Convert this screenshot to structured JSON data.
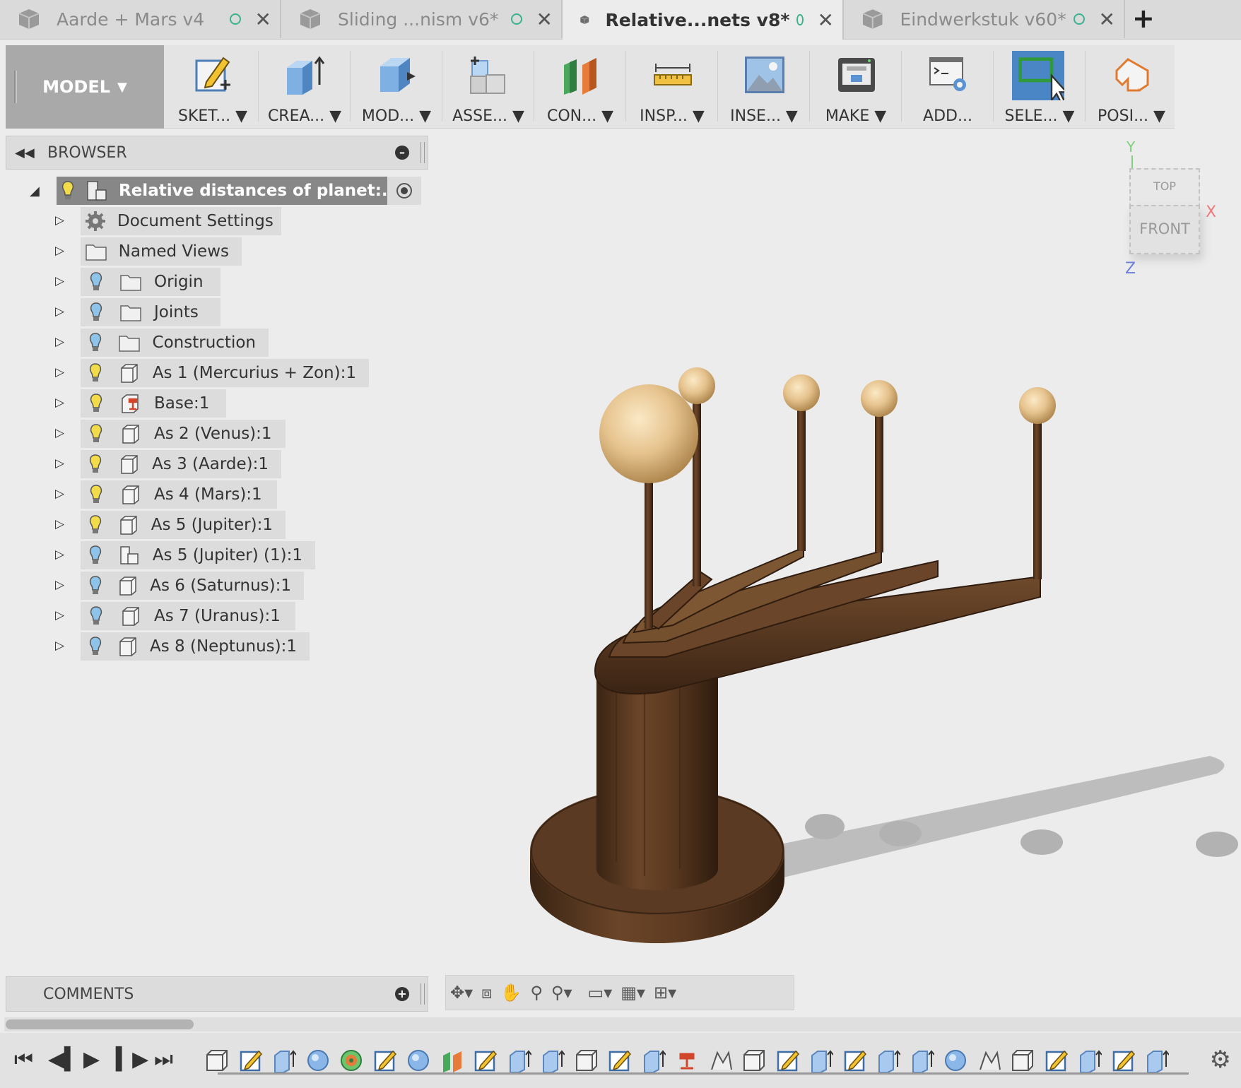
{
  "tabs": [
    {
      "label": "Aarde + Mars v4",
      "active": false
    },
    {
      "label": "Sliding ...nism v6*",
      "active": false
    },
    {
      "label": "Relative...nets v8*",
      "active": true
    },
    {
      "label": "Eindwerkstuk v60*",
      "active": false
    }
  ],
  "new_tab": "+",
  "tab_close": "✕",
  "toolbar": {
    "workspace": "MODEL",
    "tools": [
      {
        "label": "SKET...",
        "icon": "sketch-icon"
      },
      {
        "label": "CREA...",
        "icon": "create-extrude-icon"
      },
      {
        "label": "MOD...",
        "icon": "modify-icon"
      },
      {
        "label": "ASSE...",
        "icon": "assemble-icon"
      },
      {
        "label": "CON...",
        "icon": "construct-icon"
      },
      {
        "label": "INSP...",
        "icon": "inspect-ruler-icon"
      },
      {
        "label": "INSE...",
        "icon": "insert-image-icon"
      },
      {
        "label": "MAKE",
        "icon": "make-3dprint-icon"
      },
      {
        "label": "ADD...",
        "icon": "addins-script-icon"
      },
      {
        "label": "SELE...",
        "icon": "select-icon"
      },
      {
        "label": "POSI...",
        "icon": "position-icon"
      }
    ]
  },
  "browser": {
    "title": "BROWSER",
    "root": "Relative distances of planet:...",
    "items": [
      {
        "label": "Document Settings",
        "icon": "gear-icon",
        "bulb": false
      },
      {
        "label": "Named Views",
        "icon": "folder-icon",
        "bulb": false
      },
      {
        "label": "Origin",
        "icon": "folder-icon",
        "bulb": "blue"
      },
      {
        "label": "Joints",
        "icon": "folder-icon",
        "bulb": "blue"
      },
      {
        "label": "Construction",
        "icon": "folder-icon",
        "bulb": "blue"
      },
      {
        "label": "As 1 (Mercurius + Zon):1",
        "icon": "component-icon",
        "bulb": "yellow"
      },
      {
        "label": "Base:1",
        "icon": "grounded-component-icon",
        "bulb": "yellow"
      },
      {
        "label": "As 2 (Venus):1",
        "icon": "component-icon",
        "bulb": "yellow"
      },
      {
        "label": "As 3 (Aarde):1",
        "icon": "component-icon",
        "bulb": "yellow"
      },
      {
        "label": "As 4 (Mars):1",
        "icon": "component-icon",
        "bulb": "yellow"
      },
      {
        "label": "As 5 (Jupiter):1",
        "icon": "component-icon",
        "bulb": "yellow"
      },
      {
        "label": "As 5 (Jupiter) (1):1",
        "icon": "assembly-icon",
        "bulb": "blue"
      },
      {
        "label": "As 6 (Saturnus):1",
        "icon": "component-icon",
        "bulb": "blue"
      },
      {
        "label": "As 7 (Uranus):1",
        "icon": "component-icon",
        "bulb": "blue"
      },
      {
        "label": "As 8 (Neptunus):1",
        "icon": "component-icon",
        "bulb": "blue"
      }
    ]
  },
  "viewcube": {
    "top": "TOP",
    "front": "FRONT",
    "x": "X",
    "y": "Y",
    "z": "Z"
  },
  "comments": {
    "title": "COMMENTS"
  },
  "colors": {
    "accent": "#4a86c6",
    "wood": "#5a3a22",
    "sphere": "#e6c38e",
    "bulb_yellow": "#f3dc4a",
    "bulb_blue": "#8ec3ea"
  }
}
